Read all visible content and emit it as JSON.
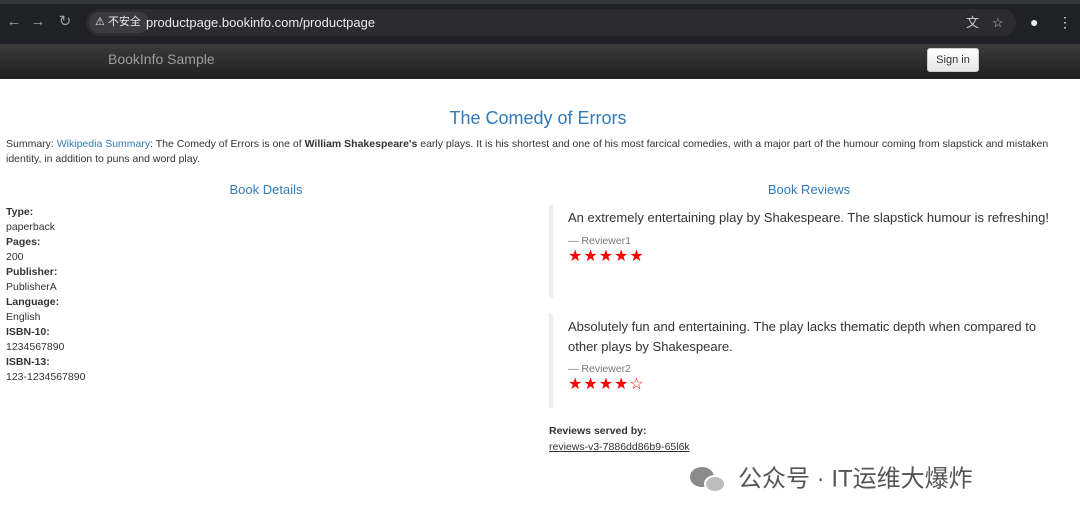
{
  "browser": {
    "security_label": "不安全",
    "url": "productpage.bookinfo.com/productpage",
    "icons": [
      "back-icon",
      "forward-icon",
      "reload-icon",
      "warning-icon",
      "translate-icon",
      "star-icon",
      "profile-icon",
      "kebab-menu-icon"
    ]
  },
  "navbar": {
    "brand": "BookInfo Sample",
    "sign_in": "Sign in"
  },
  "book": {
    "title": "The Comedy of Errors",
    "summary_prefix": "Summary: ",
    "summary_link": "Wikipedia Summary",
    "summary_mid": ": The Comedy of Errors is one of ",
    "summary_bold": "William Shakespeare's",
    "summary_rest": " early plays. It is his shortest and one of his most farcical comedies, with a major part of the humour coming from slapstick and mistaken identity, in addition to puns and word play."
  },
  "details": {
    "heading": "Book Details",
    "type_label": "Type:",
    "type_value": "paperback",
    "pages_label": "Pages:",
    "pages_value": "200",
    "publisher_label": "Publisher:",
    "publisher_value": "PublisherA",
    "language_label": "Language:",
    "language_value": "English",
    "isbn10_label": "ISBN-10:",
    "isbn10_value": "1234567890",
    "isbn13_label": "ISBN-13:",
    "isbn13_value": "123-1234567890"
  },
  "reviews": {
    "heading": "Book Reviews",
    "items": [
      {
        "text": "An extremely entertaining play by Shakespeare. The slapstick humour is refreshing!",
        "reviewer": "— Reviewer1",
        "rating": 5,
        "max_rating": 5
      },
      {
        "text": "Absolutely fun and entertaining. The play lacks thematic depth when compared to other plays by Shakespeare.",
        "reviewer": "— Reviewer2",
        "rating": 4,
        "max_rating": 5
      }
    ],
    "star_color": "#ff0000",
    "served_label": "Reviews served by:",
    "served_value": "reviews-v3-7886dd86b9-65l6k"
  },
  "watermark": {
    "text": "公众号 · IT运维大爆炸",
    "icon": "wechat-icon"
  },
  "colors": {
    "link": "#337ab7",
    "navbar": "#222222"
  }
}
